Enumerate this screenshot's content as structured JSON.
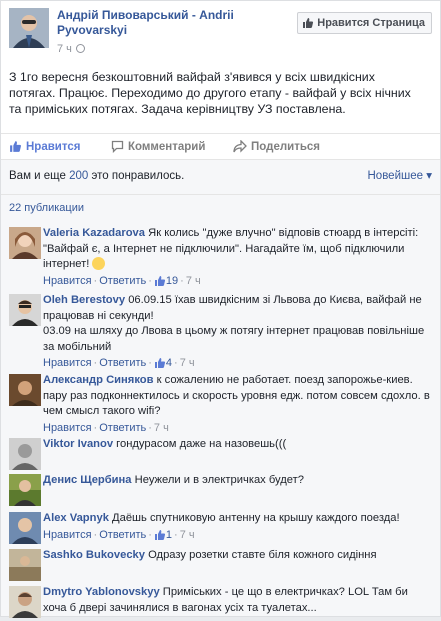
{
  "post": {
    "author": "Андрій Пивоварський - Andrii Pyvovarskyi",
    "time": "7 ч",
    "like_page": "Нравится Страница",
    "text": "З 1го вересня безкоштовний вайфай з'явився у всіх швидкісних потягах. Працює. Переходимо до другого етапу - вайфай у всіх нічних та приміських потягах. Задача керівництву УЗ поставлена."
  },
  "actions": {
    "like": "Нравится",
    "comment": "Комментарий",
    "share": "Поделиться"
  },
  "likes": {
    "prefix": "Вам и еще ",
    "count": "200",
    "suffix": " это понравилось.",
    "sort": "Новейшее ▾"
  },
  "comments_count": "22 публикации",
  "meta_labels": {
    "like": "Нравится",
    "reply": "Ответить",
    "sep": "·"
  },
  "comments": [
    {
      "name": "Valeria Kazadarova",
      "text": "Як колись \"дуже влучно\" відповів стюард в інтерсіті: \"Вайфай є, а Інтернет не підключили\". Нагадайте їм, щоб підключили інтернет!",
      "likes": "19",
      "time": "7 ч"
    },
    {
      "name": "Oleh Berestovy",
      "text": "06.09.15 їхав швидкісним зі Львова до Києва, вайфай не працював ні секунди!\n03.09 на шляху до Лвова в цьому ж потягу інтернет працював повільніше за мобільний",
      "likes": "4",
      "time": "7 ч"
    },
    {
      "name": "Александр Синяков",
      "text": "к сожалению не работает. поезд запорожье-киев. пару раз подконнектилось и скорость уровня едж. потом совсем сдохло. в чем смысл такого wifi?",
      "likes": "",
      "time": "7 ч"
    },
    {
      "name": "Viktor Ivanov",
      "text": "гондурасом даже на назовешь(((",
      "likes": "",
      "time": ""
    },
    {
      "name": "Денис Щербина",
      "text": "Неужели и в электричках будет?",
      "likes": "",
      "time": ""
    },
    {
      "name": "Alex Vapnyk",
      "text": "Даёшь спутниковую антенну на крышу каждого поезда!",
      "likes": "1",
      "time": "7 ч"
    },
    {
      "name": "Sashko Bukovecky",
      "text": "Одразу розетки ставте біля кожного сидіння",
      "likes": "",
      "time": ""
    },
    {
      "name": "Dmytro Yablonovskyy",
      "text": "Приміських - це що в електричках? LOL Там би хоча б двері зачинялися в вагонах усіх та туалетах...",
      "likes": "",
      "time": ""
    }
  ],
  "colors": {
    "link": "#365899",
    "liked": "#5b7bd5",
    "muted": "#90949c"
  }
}
